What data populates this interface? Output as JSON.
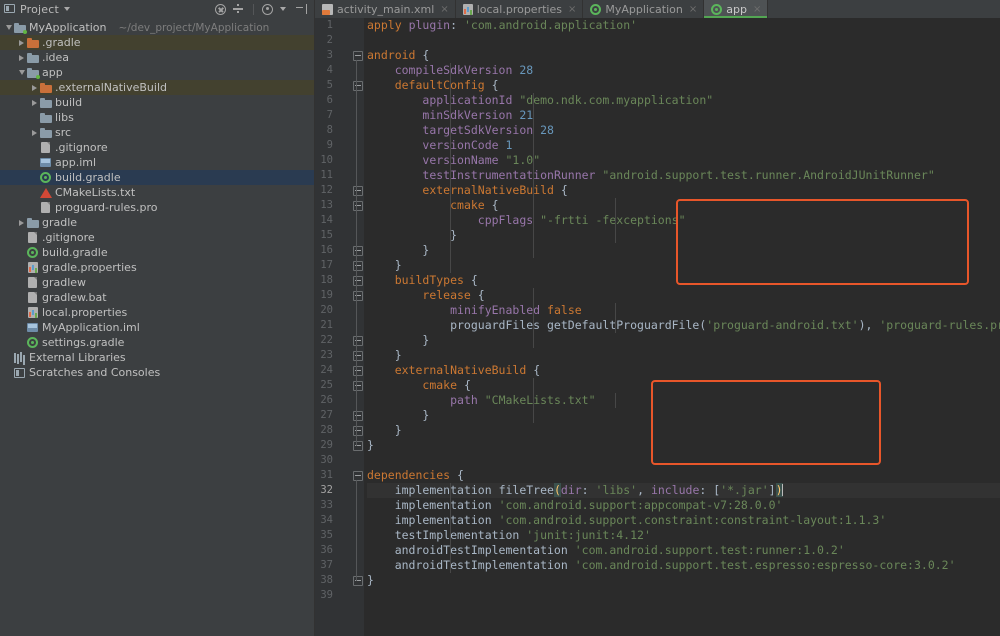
{
  "panel": {
    "title": "Project",
    "icons": [
      {
        "name": "collapse-all-icon"
      },
      {
        "name": "expand-all-icon"
      },
      {
        "name": "settings-gear-icon"
      },
      {
        "name": "hide-panel-icon"
      }
    ]
  },
  "tabs": [
    {
      "label": "activity_main.xml",
      "icon": "xml-file-icon",
      "active": false,
      "close": "×"
    },
    {
      "label": "local.properties",
      "icon": "properties-file-icon",
      "active": false,
      "close": "×"
    },
    {
      "label": "MyApplication",
      "icon": "gradle-file-icon",
      "active": false,
      "close": "×"
    },
    {
      "label": "app",
      "icon": "gradle-file-icon",
      "active": true,
      "close": "×"
    }
  ],
  "tree": [
    {
      "label": "MyApplication",
      "path": "~/dev_project/MyApplication",
      "depth": 0,
      "arrow": "down",
      "icon": "module-folder-icon",
      "state": "normal"
    },
    {
      "label": ".gradle",
      "depth": 1,
      "arrow": "right",
      "icon": "excluded-folder-icon",
      "state": "excluded"
    },
    {
      "label": ".idea",
      "depth": 1,
      "arrow": "right",
      "icon": "folder-icon",
      "state": "normal"
    },
    {
      "label": "app",
      "depth": 1,
      "arrow": "down",
      "icon": "module-folder-icon",
      "state": "normal"
    },
    {
      "label": ".externalNativeBuild",
      "depth": 2,
      "arrow": "right",
      "icon": "excluded-folder-icon",
      "state": "excluded"
    },
    {
      "label": "build",
      "depth": 2,
      "arrow": "right",
      "icon": "folder-icon",
      "state": "normal"
    },
    {
      "label": "libs",
      "depth": 2,
      "arrow": "none",
      "icon": "folder-icon",
      "state": "normal"
    },
    {
      "label": "src",
      "depth": 2,
      "arrow": "right",
      "icon": "folder-icon",
      "state": "normal"
    },
    {
      "label": ".gitignore",
      "depth": 2,
      "arrow": "none",
      "icon": "file-icon",
      "state": "normal"
    },
    {
      "label": "app.iml",
      "depth": 2,
      "arrow": "none",
      "icon": "iml-file-icon",
      "state": "normal"
    },
    {
      "label": "build.gradle",
      "depth": 2,
      "arrow": "none",
      "icon": "gradle-file-icon",
      "state": "selected"
    },
    {
      "label": "CMakeLists.txt",
      "depth": 2,
      "arrow": "none",
      "icon": "cmake-file-icon",
      "state": "normal"
    },
    {
      "label": "proguard-rules.pro",
      "depth": 2,
      "arrow": "none",
      "icon": "file-icon",
      "state": "normal"
    },
    {
      "label": "gradle",
      "depth": 1,
      "arrow": "right",
      "icon": "folder-icon",
      "state": "normal"
    },
    {
      "label": ".gitignore",
      "depth": 1,
      "arrow": "none",
      "icon": "file-icon",
      "state": "normal"
    },
    {
      "label": "build.gradle",
      "depth": 1,
      "arrow": "none",
      "icon": "gradle-file-icon",
      "state": "normal"
    },
    {
      "label": "gradle.properties",
      "depth": 1,
      "arrow": "none",
      "icon": "properties-file-icon",
      "state": "normal"
    },
    {
      "label": "gradlew",
      "depth": 1,
      "arrow": "none",
      "icon": "file-icon",
      "state": "normal"
    },
    {
      "label": "gradlew.bat",
      "depth": 1,
      "arrow": "none",
      "icon": "file-icon",
      "state": "normal"
    },
    {
      "label": "local.properties",
      "depth": 1,
      "arrow": "none",
      "icon": "properties-file-icon",
      "state": "normal"
    },
    {
      "label": "MyApplication.iml",
      "depth": 1,
      "arrow": "none",
      "icon": "iml-file-icon",
      "state": "normal"
    },
    {
      "label": "settings.gradle",
      "depth": 1,
      "arrow": "none",
      "icon": "gradle-file-icon",
      "state": "normal"
    },
    {
      "label": "External Libraries",
      "depth": 0,
      "arrow": "none",
      "icon": "external-libraries-icon",
      "state": "normal"
    },
    {
      "label": "Scratches and Consoles",
      "depth": 0,
      "arrow": "none",
      "icon": "scratches-icon",
      "state": "normal"
    }
  ],
  "editor": {
    "file": "build.gradle",
    "current_line": 32,
    "total_lines": 39,
    "lines": [
      {
        "n": 1,
        "text": "apply plugin: 'com.android.application'"
      },
      {
        "n": 2,
        "text": ""
      },
      {
        "n": 3,
        "text": "android {"
      },
      {
        "n": 4,
        "text": "    compileSdkVersion 28"
      },
      {
        "n": 5,
        "text": "    defaultConfig {"
      },
      {
        "n": 6,
        "text": "        applicationId \"demo.ndk.com.myapplication\""
      },
      {
        "n": 7,
        "text": "        minSdkVersion 21"
      },
      {
        "n": 8,
        "text": "        targetSdkVersion 28"
      },
      {
        "n": 9,
        "text": "        versionCode 1"
      },
      {
        "n": 10,
        "text": "        versionName \"1.0\""
      },
      {
        "n": 11,
        "text": "        testInstrumentationRunner \"android.support.test.runner.AndroidJUnitRunner\""
      },
      {
        "n": 12,
        "text": "        externalNativeBuild {"
      },
      {
        "n": 13,
        "text": "            cmake {"
      },
      {
        "n": 14,
        "text": "                cppFlags \"-frtti -fexceptions\""
      },
      {
        "n": 15,
        "text": "            }"
      },
      {
        "n": 16,
        "text": "        }"
      },
      {
        "n": 17,
        "text": "    }"
      },
      {
        "n": 18,
        "text": "    buildTypes {"
      },
      {
        "n": 19,
        "text": "        release {"
      },
      {
        "n": 20,
        "text": "            minifyEnabled false"
      },
      {
        "n": 21,
        "text": "            proguardFiles getDefaultProguardFile('proguard-android.txt'), 'proguard-rules.pro'"
      },
      {
        "n": 22,
        "text": "        }"
      },
      {
        "n": 23,
        "text": "    }"
      },
      {
        "n": 24,
        "text": "    externalNativeBuild {"
      },
      {
        "n": 25,
        "text": "        cmake {"
      },
      {
        "n": 26,
        "text": "            path \"CMakeLists.txt\""
      },
      {
        "n": 27,
        "text": "        }"
      },
      {
        "n": 28,
        "text": "    }"
      },
      {
        "n": 29,
        "text": "}"
      },
      {
        "n": 30,
        "text": ""
      },
      {
        "n": 31,
        "text": "dependencies {"
      },
      {
        "n": 32,
        "text": "    implementation fileTree(dir: 'libs', include: ['*.jar'])"
      },
      {
        "n": 33,
        "text": "    implementation 'com.android.support:appcompat-v7:28.0.0'"
      },
      {
        "n": 34,
        "text": "    implementation 'com.android.support.constraint:constraint-layout:1.1.3'"
      },
      {
        "n": 35,
        "text": "    testImplementation 'junit:junit:4.12'"
      },
      {
        "n": 36,
        "text": "    androidTestImplementation 'com.android.support.test:runner:1.0.2'"
      },
      {
        "n": 37,
        "text": "    androidTestImplementation 'com.android.support.test.espresso:espresso-core:3.0.2'"
      },
      {
        "n": 38,
        "text": "}"
      },
      {
        "n": 39,
        "text": ""
      }
    ],
    "fold_lines": [
      3,
      5,
      12,
      13,
      16,
      17,
      18,
      19,
      22,
      23,
      24,
      25,
      27,
      28,
      29,
      31,
      38
    ],
    "annotations": [
      {
        "name": "externalNativeBuild-defaultConfig-highlight",
        "lines": "12-16",
        "color": "#e8562a"
      },
      {
        "name": "externalNativeBuild-android-highlight",
        "lines": "24-28",
        "color": "#e8562a"
      }
    ]
  },
  "colors": {
    "keyword": "#cc7832",
    "property": "#9876aa",
    "string": "#6a8759",
    "number": "#6897bb",
    "default_text": "#a9b7c6",
    "editor_bg": "#2b2b2b",
    "gutter_bg": "#313335",
    "panel_bg": "#3c3f41",
    "selection_bg": "#2a3b51",
    "excluded_bg": "#43412f",
    "accent": "#e8562a",
    "tab_active_underline": "#53a653"
  }
}
